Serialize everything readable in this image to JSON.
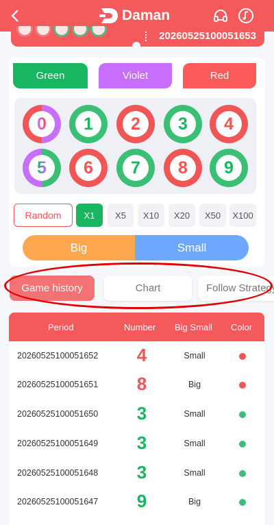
{
  "header": {
    "back_icon": "chevron-left-icon",
    "brand": "Daman",
    "support_icon": "headset-icon",
    "music_icon": "music-note-icon"
  },
  "current": {
    "period": "20260525100051653"
  },
  "color_buttons": {
    "green": "Green",
    "violet": "Violet",
    "red": "Red"
  },
  "numbers": [
    "0",
    "1",
    "2",
    "3",
    "4",
    "5",
    "6",
    "7",
    "8",
    "9"
  ],
  "multipliers": {
    "random": "Random",
    "items": [
      "X1",
      "X5",
      "X10",
      "X20",
      "X50",
      "X100"
    ]
  },
  "bigsmall": {
    "big": "Big",
    "small": "Small"
  },
  "tabs": [
    "Game history",
    "Chart",
    "Follow Strategy"
  ],
  "history": {
    "columns": [
      "Period",
      "Number",
      "Big Small",
      "Color"
    ],
    "rows": [
      {
        "period": "20260525100051652",
        "number": "4",
        "bs": "Small",
        "color": "red"
      },
      {
        "period": "20260525100051651",
        "number": "8",
        "bs": "Big",
        "color": "red"
      },
      {
        "period": "20260525100051650",
        "number": "3",
        "bs": "Small",
        "color": "green"
      },
      {
        "period": "20260525100051649",
        "number": "3",
        "bs": "Small",
        "color": "green"
      },
      {
        "period": "20260525100051648",
        "number": "3",
        "bs": "Small",
        "color": "green"
      },
      {
        "period": "20260525100051647",
        "number": "9",
        "bs": "Big",
        "color": "green"
      }
    ]
  },
  "colors": {
    "primary": "#f45a5c",
    "green": "#18b660",
    "violet": "#c86eff",
    "red": "#fb5b5b",
    "big": "#ffa74f",
    "small": "#6ea8fe"
  }
}
